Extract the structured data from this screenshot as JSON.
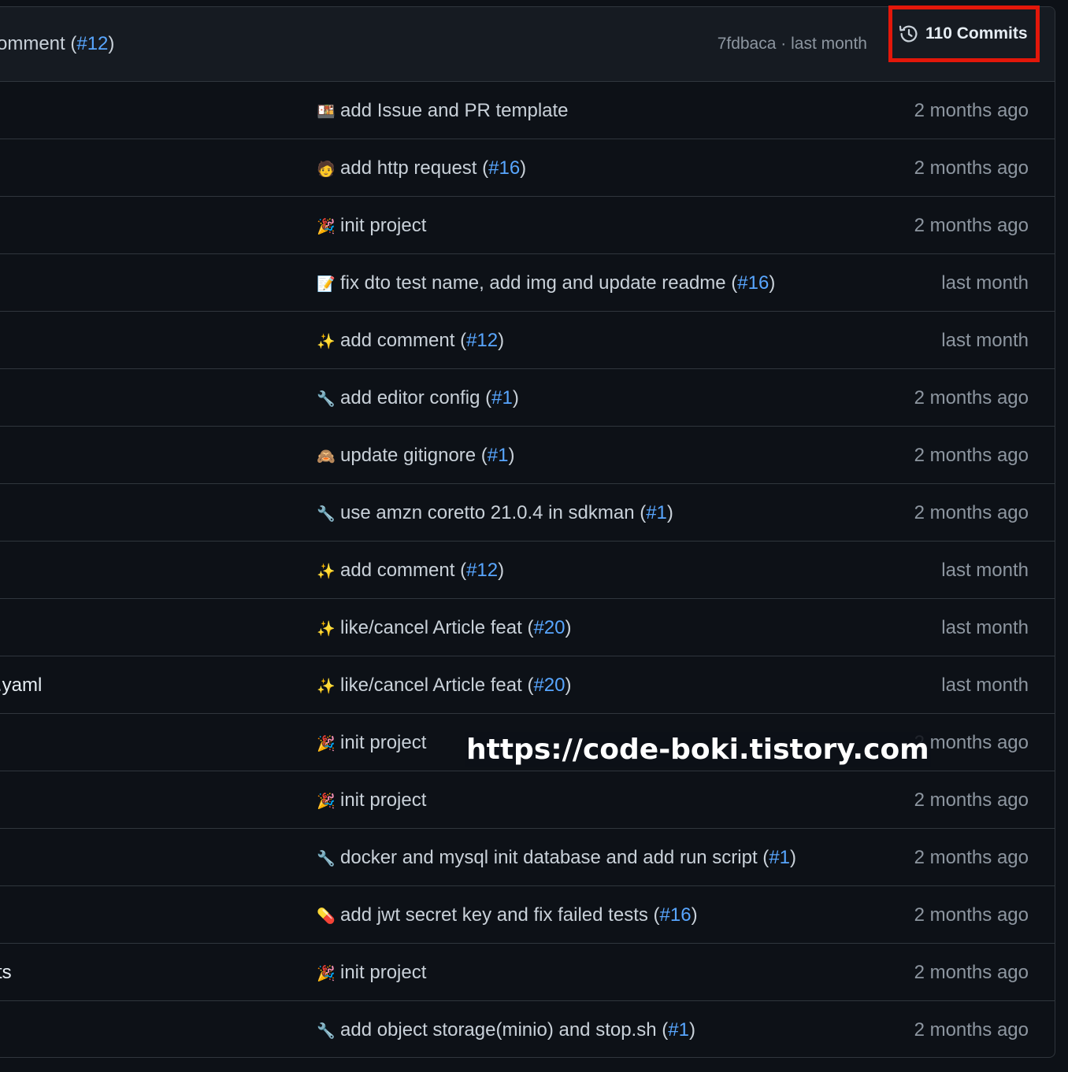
{
  "header": {
    "message_prefix": "omment (",
    "message_link": "#12",
    "message_suffix": ")",
    "commit_hash": "7fdbaca",
    "separator": "·",
    "commit_time": "last month",
    "commits_label": "110 Commits",
    "commits_icon": "history-icon"
  },
  "rows": [
    {
      "file": "",
      "emoji": "🍱",
      "text": "add Issue and PR template",
      "link": "",
      "time": "2 months ago"
    },
    {
      "file": "",
      "emoji": "🧑",
      "text": "add http request (",
      "link": "#16",
      "close": ")",
      "time": "2 months ago"
    },
    {
      "file": "",
      "emoji": "🎉",
      "text": "init project",
      "link": "",
      "time": "2 months ago"
    },
    {
      "file": "",
      "emoji": "📝",
      "text": "fix dto test name, add img and update readme (",
      "link": "#16",
      "close": ")",
      "time": "last month"
    },
    {
      "file": "",
      "emoji": "✨",
      "text": "add comment (",
      "link": "#12",
      "close": ")",
      "time": "last month"
    },
    {
      "file": "",
      "emoji": "🔧",
      "text": "add editor config (",
      "link": "#1",
      "close": ")",
      "time": "2 months ago"
    },
    {
      "file": "",
      "emoji": "🙈",
      "text": "update gitignore (",
      "link": "#1",
      "close": ")",
      "time": "2 months ago"
    },
    {
      "file": "",
      "emoji": "🔧",
      "text": "use amzn coretto 21.0.4 in sdkman (",
      "link": "#1",
      "close": ")",
      "time": "2 months ago"
    },
    {
      "file": "",
      "emoji": "✨",
      "text": "add comment (",
      "link": "#12",
      "close": ")",
      "time": "last month"
    },
    {
      "file": "",
      "emoji": "✨",
      "text": "like/cancel Article feat (",
      "link": "#20",
      "close": ")",
      "time": "last month"
    },
    {
      "file": ".yaml",
      "emoji": "✨",
      "text": "like/cancel Article feat (",
      "link": "#20",
      "close": ")",
      "time": "last month"
    },
    {
      "file": "",
      "emoji": "🎉",
      "text": "init project",
      "link": "",
      "time": "2 months ago"
    },
    {
      "file": "",
      "emoji": "🎉",
      "text": "init project",
      "link": "",
      "time": "2 months ago"
    },
    {
      "file": "",
      "emoji": "🔧",
      "text": "docker and mysql init database and add run script (",
      "link": "#1",
      "close": ")",
      "time": "2 months ago"
    },
    {
      "file": "",
      "emoji": "💊",
      "text": "add jwt secret key and fix failed tests (",
      "link": "#16",
      "close": ")",
      "time": "2 months ago"
    },
    {
      "file": "ts",
      "emoji": "🎉",
      "text": "init project",
      "link": "",
      "time": "2 months ago"
    },
    {
      "file": "",
      "emoji": "🔧",
      "text": "add object storage(minio) and stop.sh (",
      "link": "#1",
      "close": ")",
      "time": "2 months ago"
    }
  ],
  "watermark": "https://code-boki.tistory.com",
  "colors": {
    "background": "#0d1117",
    "header_bg": "#161b22",
    "border": "#30363d",
    "link": "#58a6ff",
    "muted": "#8d96a0",
    "highlight": "#e3170a"
  }
}
